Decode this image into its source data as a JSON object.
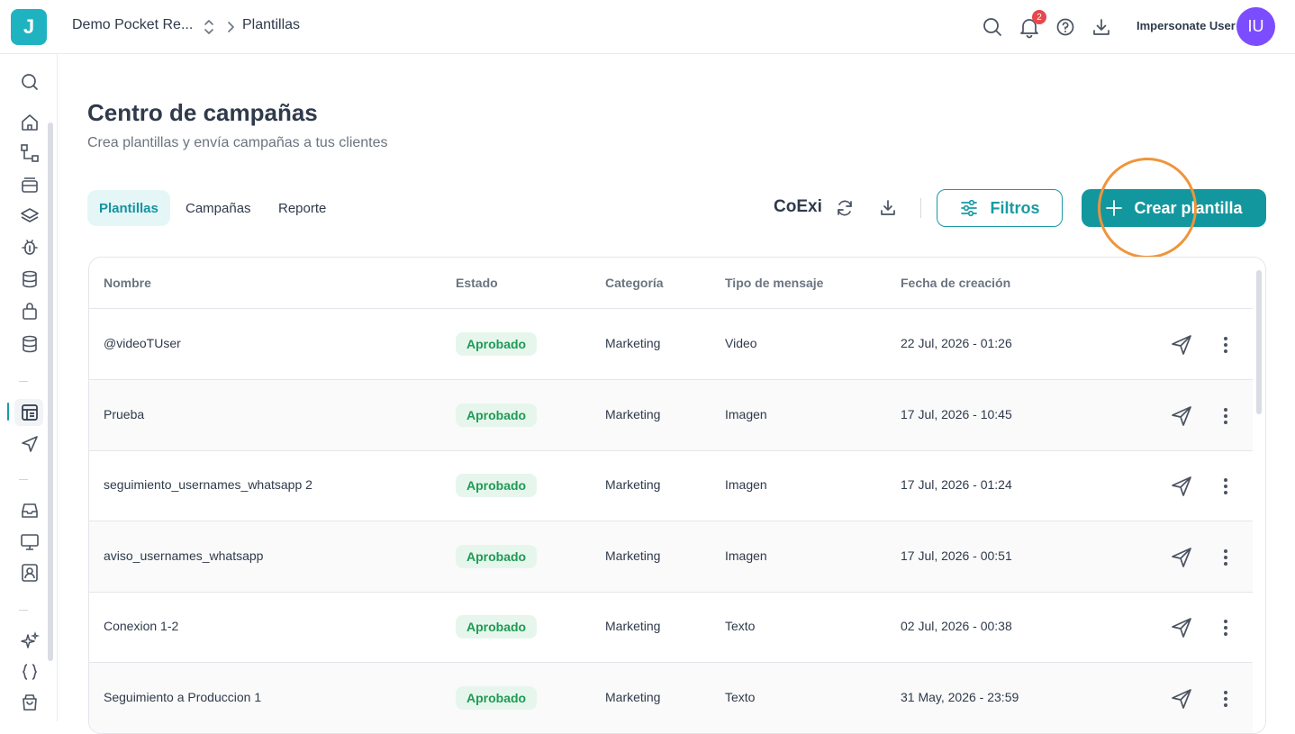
{
  "app": {
    "logo_letter": "J"
  },
  "header": {
    "workspace": "Demo Pocket Re...",
    "breadcrumb_page": "Plantillas",
    "notifications_count": "2",
    "impersonate_label": "Impersonate User",
    "avatar_initials": "IU"
  },
  "page": {
    "title": "Centro de campañas",
    "subtitle": "Crea plantillas y envía campañas a tus clientes"
  },
  "tabs": [
    {
      "label": "Plantillas",
      "active": true
    },
    {
      "label": "Campañas",
      "active": false
    },
    {
      "label": "Reporte",
      "active": false
    }
  ],
  "toolbar": {
    "account": "CoExi",
    "filters_label": "Filtros",
    "create_label": "Crear plantilla"
  },
  "table": {
    "columns": [
      "Nombre",
      "Estado",
      "Categoría",
      "Tipo de mensaje",
      "Fecha de creación"
    ],
    "rows": [
      {
        "name": "@videoTUser",
        "status": "Aprobado",
        "category": "Marketing",
        "type": "Video",
        "date": "22 Jul, 2026 - 01:26"
      },
      {
        "name": "Prueba",
        "status": "Aprobado",
        "category": "Marketing",
        "type": "Imagen",
        "date": "17 Jul, 2026 - 10:45"
      },
      {
        "name": "seguimiento_usernames_whatsapp 2",
        "status": "Aprobado",
        "category": "Marketing",
        "type": "Imagen",
        "date": "17 Jul, 2026 - 01:24"
      },
      {
        "name": "aviso_usernames_whatsapp",
        "status": "Aprobado",
        "category": "Marketing",
        "type": "Imagen",
        "date": "17 Jul, 2026 - 00:51"
      },
      {
        "name": "Conexion 1-2",
        "status": "Aprobado",
        "category": "Marketing",
        "type": "Texto",
        "date": "02 Jul, 2026 - 00:38"
      },
      {
        "name": "Seguimiento a Produccion 1",
        "status": "Aprobado",
        "category": "Marketing",
        "type": "Texto",
        "date": "31 May, 2026 - 23:59"
      }
    ]
  },
  "colors": {
    "accent": "#13979f",
    "approved_bg": "#e6f6ec",
    "approved_text": "#1f9a55",
    "highlight": "#f0943a"
  }
}
